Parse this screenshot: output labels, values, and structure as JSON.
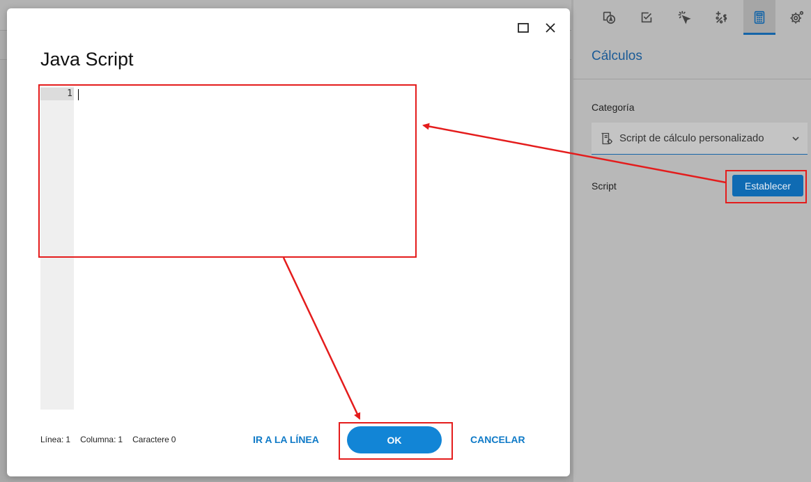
{
  "dialog": {
    "title": "Java Script",
    "line_number": "1",
    "status": {
      "line_label": "Línea:",
      "line_value": "1",
      "column_label": "Columna:",
      "column_value": "1",
      "chars_label": "Caractere",
      "chars_value": "0"
    },
    "buttons": {
      "goto_line": "IR A LA LÍNEA",
      "ok": "OK",
      "cancel": "CANCELAR"
    }
  },
  "panel": {
    "title": "Cálculos",
    "category_label": "Categoría",
    "category_value": "Script de cálculo personalizado",
    "script_label": "Script",
    "set_button": "Establecer",
    "toolbar_icons": [
      "appearance-icon",
      "checkbox-icon",
      "action-icon",
      "format-icon",
      "calculator-icon",
      "settings-icon"
    ],
    "active_tool": "calculator-icon"
  },
  "colors": {
    "accent": "#1285d6",
    "annotation": "#e41c1c",
    "panel_title": "#1a5a96"
  }
}
